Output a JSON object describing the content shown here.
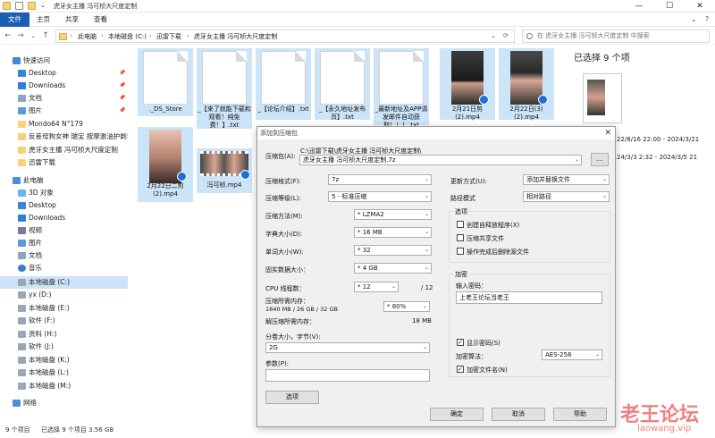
{
  "window": {
    "title": "虎牙女主播 冯可桢大尺度定制",
    "minimize": "—",
    "maximize": "☐",
    "close": "✕",
    "help": "?"
  },
  "ribbon": {
    "tabs": [
      "文件",
      "主页",
      "共享",
      "查看"
    ],
    "expand": "⌄"
  },
  "address": {
    "back": "←",
    "forward": "→",
    "history": "⌄",
    "up": "↑",
    "breadcrumbs": [
      "此电脑",
      "本地磁盘 (C:)",
      "迅雷下载",
      "虎牙女主播 冯可桢大尺度定制"
    ],
    "separator": "›",
    "dropdown": "⌄",
    "refresh": "⟳",
    "search_placeholder": "在 虎牙女主播 冯可桢大尺度定制 中搜索"
  },
  "nav": {
    "quick_access": "快速访问",
    "pinned": [
      {
        "label": "Desktop",
        "icon": "desktop-icon"
      },
      {
        "label": "Downloads",
        "icon": "downloads-icon"
      },
      {
        "label": "文档",
        "icon": "documents-icon"
      },
      {
        "label": "图片",
        "icon": "pictures-icon"
      }
    ],
    "recent": [
      "Mondo64 N°179",
      "反差母狗女神 瑞宝 按摩激油护剃毛",
      "虎牙女主播 冯可桢大尺度定制",
      "迅雷下载"
    ],
    "this_pc": "此电脑",
    "pc_items": [
      "3D 对象",
      "Desktop",
      "Downloads",
      "视频",
      "图片",
      "文档",
      "音乐",
      "本地磁盘 (C:)"
    ],
    "drives": [
      "yx (D:)",
      "本地磁盘 (E:)",
      "软件 (F:)",
      "资料 (H:)",
      "软件 (J:)",
      "本地磁盘 (K:)",
      "本地磁盘 (L:)",
      "本地磁盘 (M:)"
    ],
    "network": "网络",
    "pin_glyph": "📌"
  },
  "files": [
    {
      "name": "._DS_Store",
      "kind": "doc"
    },
    {
      "name": "_【来了就能下载和观看！纯免费！】.txt",
      "kind": "doc"
    },
    {
      "name": "_【论坛介绍】.txt",
      "kind": "doc"
    },
    {
      "name": "_【永久地址发布页】.txt",
      "kind": "doc"
    },
    {
      "name": "_最新地址及APP请发邮件自动获取！！！.txt",
      "kind": "doc"
    },
    {
      "name": "2月21日剪(2).mp4",
      "kind": "video"
    },
    {
      "name": "2月22日(3)(2).mp4",
      "kind": "video"
    },
    {
      "name": "2月22日二剪(2).mp4",
      "kind": "video"
    },
    {
      "name": "冯可桢.mp4",
      "kind": "video-wide"
    }
  ],
  "details": {
    "title": "已选择 9 个项",
    "lines": [
      "22/8/16 22:00 - 2024/3/21",
      "24/3/3 2:32 - 2024/3/5 21"
    ]
  },
  "status": {
    "count": "9 个项目",
    "selected": "已选择 9 个项目  3.56 GB"
  },
  "dialog": {
    "title": "添加到压缩包",
    "close": "✕",
    "archive_label": "压缩包(A):",
    "archive_path": "C:\\迅雷下载\\虎牙女主播 冯可桢大尺度定制\\",
    "archive_name": "虎牙女主播 冯可桢大尺度定制.7z",
    "browse": "...",
    "format_label": "压缩格式(F):",
    "format_value": "7z",
    "level_label": "压缩等级(L):",
    "level_value": "5 - 标准压缩",
    "method_label": "压缩方法(M):",
    "method_value": "* LZMA2",
    "dict_label": "字典大小(D):",
    "dict_value": "* 16 MB",
    "word_label": "单词大小(W):",
    "word_value": "* 32",
    "solid_label": "固实数据大小：",
    "solid_value": "* 4 GB",
    "cpu_label": "CPU 线程数：",
    "cpu_value": "* 12",
    "cpu_max": "/ 12",
    "mem_label": "压缩所需内存：",
    "mem_detail": "1840 MB / 26 GB / 32 GB",
    "mem_value": "* 80%",
    "demem_label": "解压缩所需内存：",
    "demem_value": "18 MB",
    "split_label": "分卷大小，字节(V):",
    "split_value": "2G",
    "params_label": "参数(P):",
    "params_value": "",
    "options_button": "选项",
    "update_label": "更新方式(U):",
    "update_value": "添加并替换文件",
    "path_label": "路径模式",
    "path_value": "相对路径",
    "options_group": "选项",
    "opt_sfx": "创建自释放程序(X)",
    "opt_shared": "压缩共享文件",
    "opt_delete": "操作完成后删除源文件",
    "encrypt_group": "加密",
    "pw_label": "输入密码：",
    "pw_value": "上老王论坛当老王",
    "show_pw": "显示密码(S)",
    "enc_method_label": "加密算法：",
    "enc_method_value": "AES-256",
    "encrypt_names": "加密文件名(N)",
    "check_glyph": "✓",
    "ok": "确定",
    "cancel": "取消",
    "help": "帮助",
    "arrow": "⌄"
  },
  "watermark": {
    "line1": "老王论坛",
    "line2": "laowang.vip"
  },
  "colors": {
    "accent": "#1a5fb4",
    "selection": "#cce4f7",
    "watermark": "#ec6a6a"
  }
}
